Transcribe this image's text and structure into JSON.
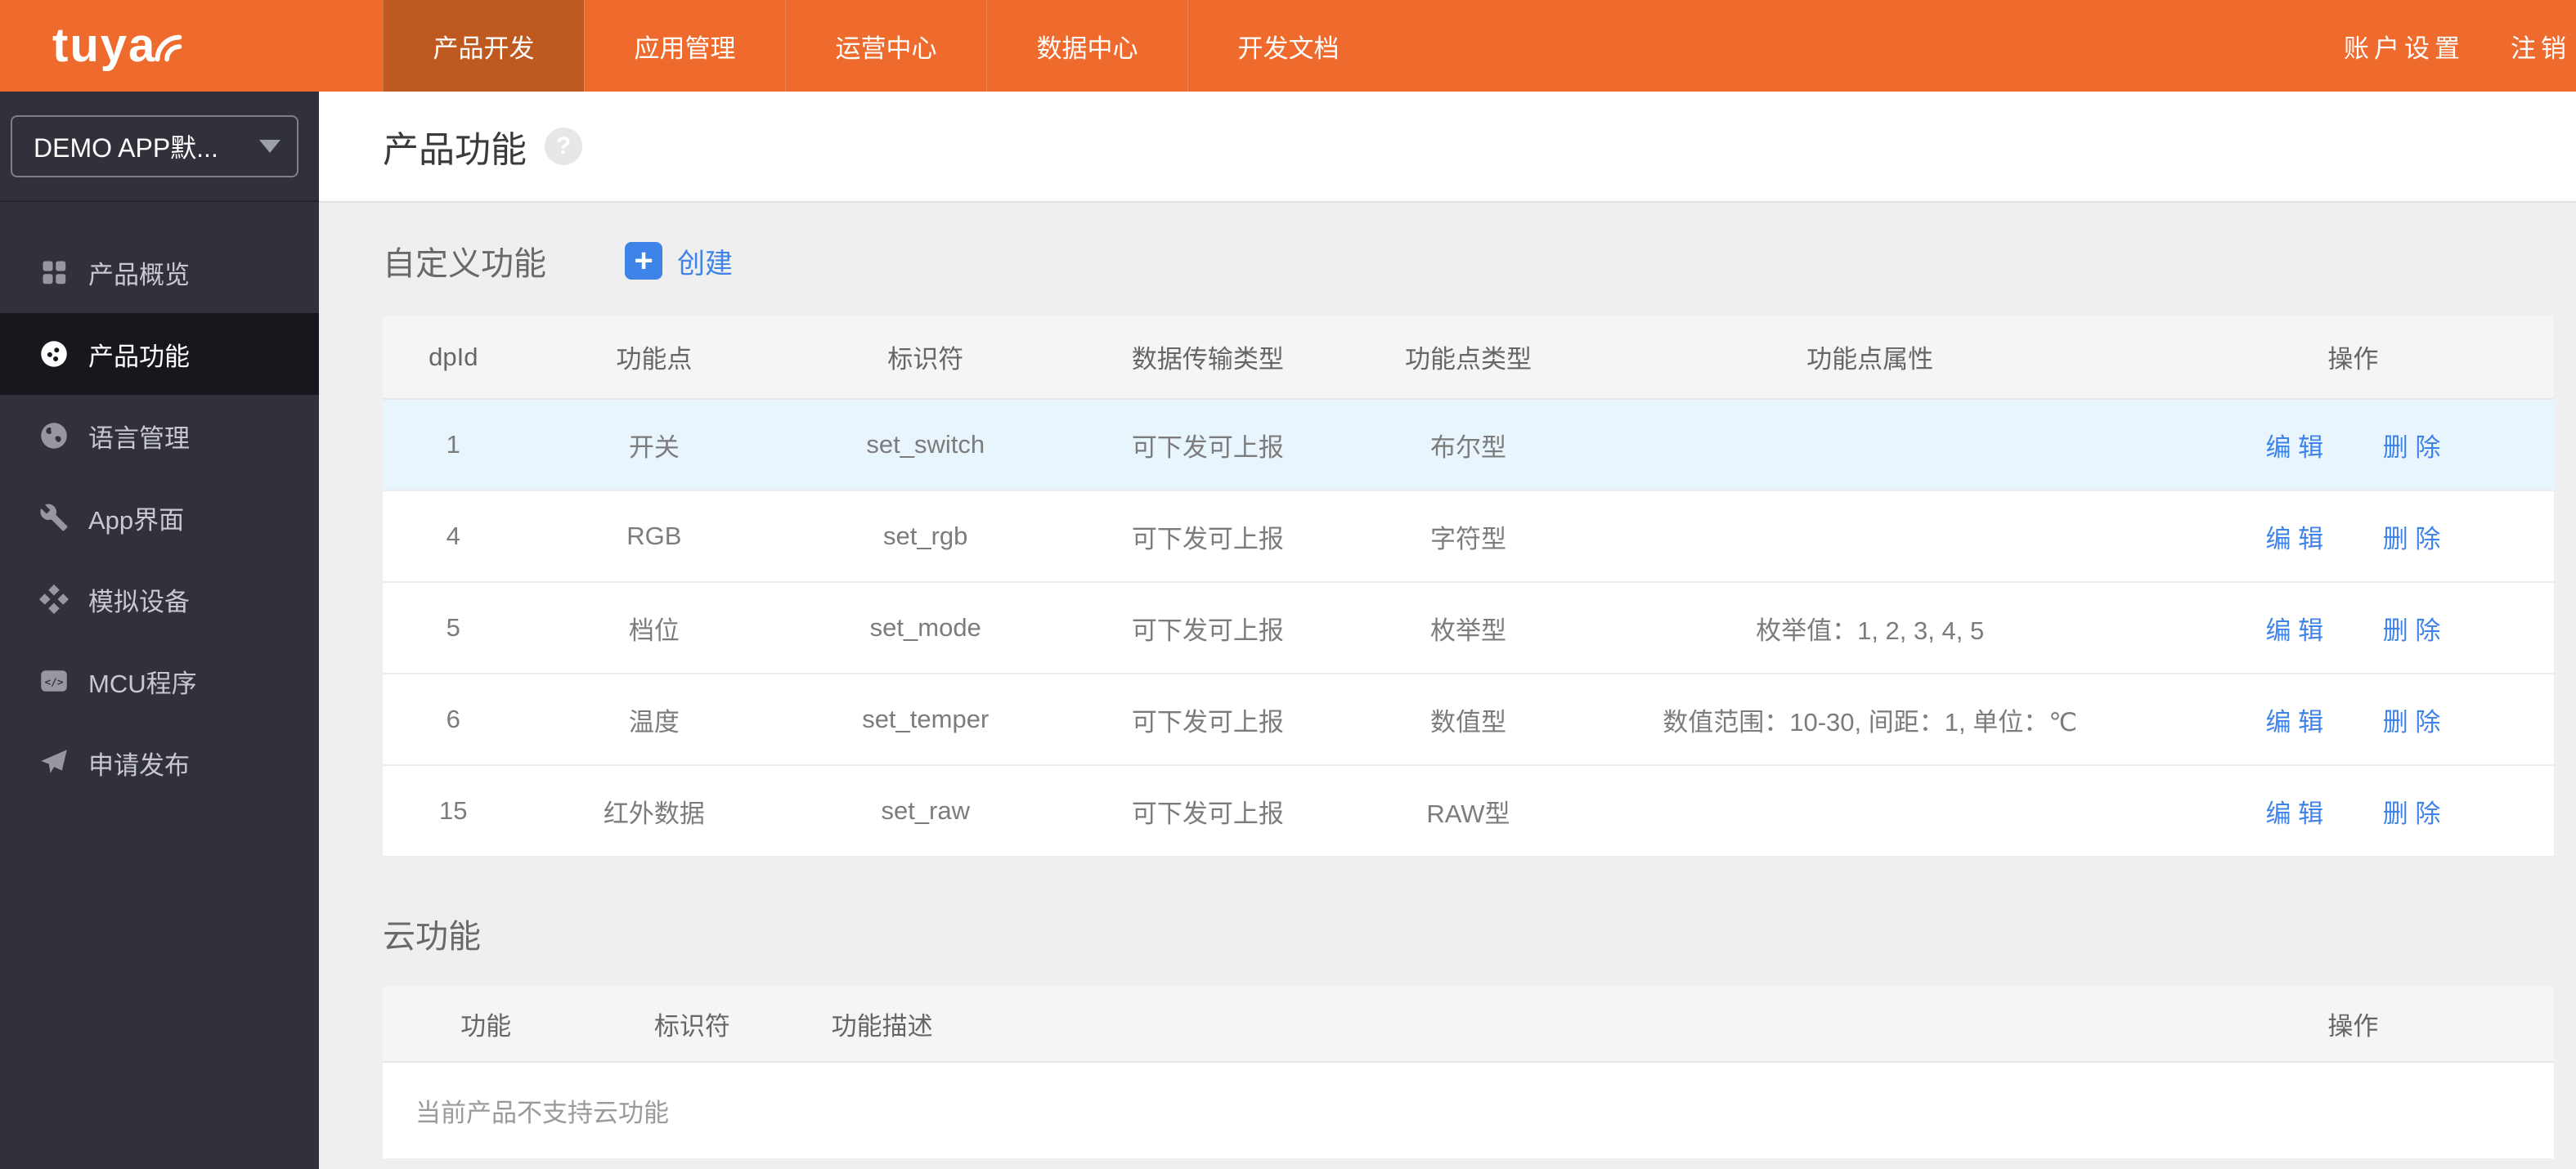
{
  "colors": {
    "topbar_orange": "#EE6B2D",
    "active_tab_orange": "#BE5A20",
    "sidebar_dark": "#30313A",
    "sidebar_active": "#17171D",
    "accent_blue": "#3E84E8",
    "row_highlight_blue": "#E9F5FC",
    "page_background": "#EFEFEF"
  },
  "topbar": {
    "logo_text": "tuya",
    "logo_signal_icon": "signal-arcs-icon",
    "tabs": [
      {
        "label": "产品开发",
        "active": true
      },
      {
        "label": "应用管理",
        "active": false
      },
      {
        "label": "运营中心",
        "active": false
      },
      {
        "label": "数据中心",
        "active": false
      },
      {
        "label": "开发文档",
        "active": false
      }
    ],
    "right_links": [
      "账户设置",
      "注销"
    ]
  },
  "sidebar": {
    "project_selector": {
      "value": "DEMO APP默...",
      "caret_icon": "chevron-down-icon"
    },
    "items": [
      {
        "label": "产品概览",
        "icon": "grid-icon",
        "active": false
      },
      {
        "label": "产品功能",
        "icon": "datapoint-icon",
        "active": true
      },
      {
        "label": "语言管理",
        "icon": "globe-icon",
        "active": false
      },
      {
        "label": "App界面",
        "icon": "wrench-icon",
        "active": false
      },
      {
        "label": "模拟设备",
        "icon": "diamonds-icon",
        "active": false
      },
      {
        "label": "MCU程序",
        "icon": "code-icon",
        "active": false
      },
      {
        "label": "申请发布",
        "icon": "send-icon",
        "active": false
      }
    ]
  },
  "page": {
    "title": "产品功能",
    "help_icon": "?"
  },
  "custom_section": {
    "heading": "自定义功能",
    "create_plus": "+",
    "create_label": "创建",
    "table": {
      "headers": [
        "dpId",
        "功能点",
        "标识符",
        "数据传输类型",
        "功能点类型",
        "功能点属性",
        "操作"
      ],
      "actions": {
        "edit": "编 辑",
        "delete": "删 除"
      },
      "rows": [
        {
          "dpId": "1",
          "name": "开关",
          "identifier": "set_switch",
          "transfer": "可下发可上报",
          "type": "布尔型",
          "attrs": "",
          "highlighted": true
        },
        {
          "dpId": "4",
          "name": "RGB",
          "identifier": "set_rgb",
          "transfer": "可下发可上报",
          "type": "字符型",
          "attrs": "",
          "highlighted": false
        },
        {
          "dpId": "5",
          "name": "档位",
          "identifier": "set_mode",
          "transfer": "可下发可上报",
          "type": "枚举型",
          "attrs": "枚举值：1, 2, 3, 4, 5",
          "highlighted": false
        },
        {
          "dpId": "6",
          "name": "温度",
          "identifier": "set_temper",
          "transfer": "可下发可上报",
          "type": "数值型",
          "attrs": "数值范围：10-30, 间距：1, 单位：℃",
          "highlighted": false
        },
        {
          "dpId": "15",
          "name": "红外数据",
          "identifier": "set_raw",
          "transfer": "可下发可上报",
          "type": "RAW型",
          "attrs": "",
          "highlighted": false
        }
      ]
    }
  },
  "cloud_section": {
    "heading": "云功能",
    "table": {
      "headers": [
        "功能",
        "标识符",
        "功能描述",
        "",
        "操作"
      ],
      "empty_text": "当前产品不支持云功能"
    }
  }
}
